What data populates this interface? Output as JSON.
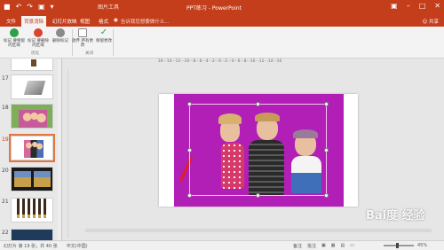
{
  "titlebar": {
    "context_tab_label": "图片工具",
    "title": "PPT练习 - PowerPoint"
  },
  "tabs": [
    {
      "label": "文件",
      "active": false
    },
    {
      "label": "背景消除",
      "active": true
    },
    {
      "label": "幻灯片放映",
      "active": false
    },
    {
      "label": "视图",
      "active": false
    },
    {
      "label": "格式",
      "active": false
    }
  ],
  "tell_me": "告诉我您想要做什么...",
  "share_label": "共享",
  "ribbon": {
    "buttons": [
      {
        "label": "标记\n要保留的区域"
      },
      {
        "label": "标记\n要删除的区域"
      },
      {
        "label": "删除标记"
      },
      {
        "label": "放弃\n所有更改"
      },
      {
        "label": "保留更改"
      }
    ],
    "groups": [
      {
        "label": "优化"
      },
      {
        "label": "关闭"
      }
    ]
  },
  "thumbnails": [
    {
      "num": "17"
    },
    {
      "num": "18"
    },
    {
      "num": "19"
    },
    {
      "num": "20"
    },
    {
      "num": "21"
    },
    {
      "num": "22"
    }
  ],
  "hruler_text": "16···14···12···10···8···6···4···2···0···2···4···6···8···10···12···14···16",
  "statusbar": {
    "slide_info": "幻灯片 第 19 张，共 40 张",
    "language": "中文(中国)",
    "notes": "备注",
    "comments": "批注",
    "zoom": "45%"
  },
  "watermark": "Bai度 经验",
  "colors": {
    "accent": "#c43e1c",
    "removed_area": "#b21fb7"
  }
}
